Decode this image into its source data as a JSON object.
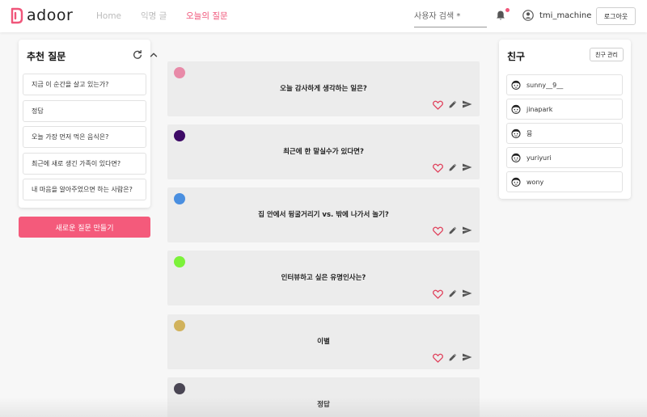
{
  "header": {
    "logo_text": "adoor",
    "nav": [
      {
        "label": "Home"
      },
      {
        "label": "익명 글"
      },
      {
        "label": "오늘의 질문"
      }
    ],
    "search_placeholder": "사용자 검색 *",
    "username": "tmi_machine",
    "logout_label": "로그아웃",
    "accent_color": "#f0567a"
  },
  "recommended": {
    "title": "추천 질문",
    "items": [
      {
        "label": "지금 이 순간을 살고 있는가?"
      },
      {
        "label": "정답"
      },
      {
        "label": "오늘 가장 먼저 먹은 음식은?"
      },
      {
        "label": "최근에 새로 생긴 가족이 있다면?"
      },
      {
        "label": "내 마음을 알아주었으면 하는 사람은?"
      }
    ],
    "new_question_label": "새로운 질문 만들기",
    "new_question_color": "#f45a7b"
  },
  "questions": [
    {
      "text": "오늘 감사하게 생각하는 일은?",
      "color": "#e88aa8"
    },
    {
      "text": "최근에 한 말실수가 있다면?",
      "color": "#3d0a66"
    },
    {
      "text": "집 안에서 뒹굴거리기 vs. 밖에 나가서 놀기?",
      "color": "#4a8fe0"
    },
    {
      "text": "인터뷰하고 싶은 유명인사는?",
      "color": "#7cf23a"
    },
    {
      "text": "이별",
      "color": "#d1b25c"
    },
    {
      "text": "정답",
      "color": "#4a4654"
    }
  ],
  "friends": {
    "title": "친구",
    "manage_label": "친구 관리",
    "items": [
      {
        "name": "sunny__9__"
      },
      {
        "name": "jinapark"
      },
      {
        "name": "뮹"
      },
      {
        "name": "yuriyuri"
      },
      {
        "name": "wony"
      }
    ]
  }
}
